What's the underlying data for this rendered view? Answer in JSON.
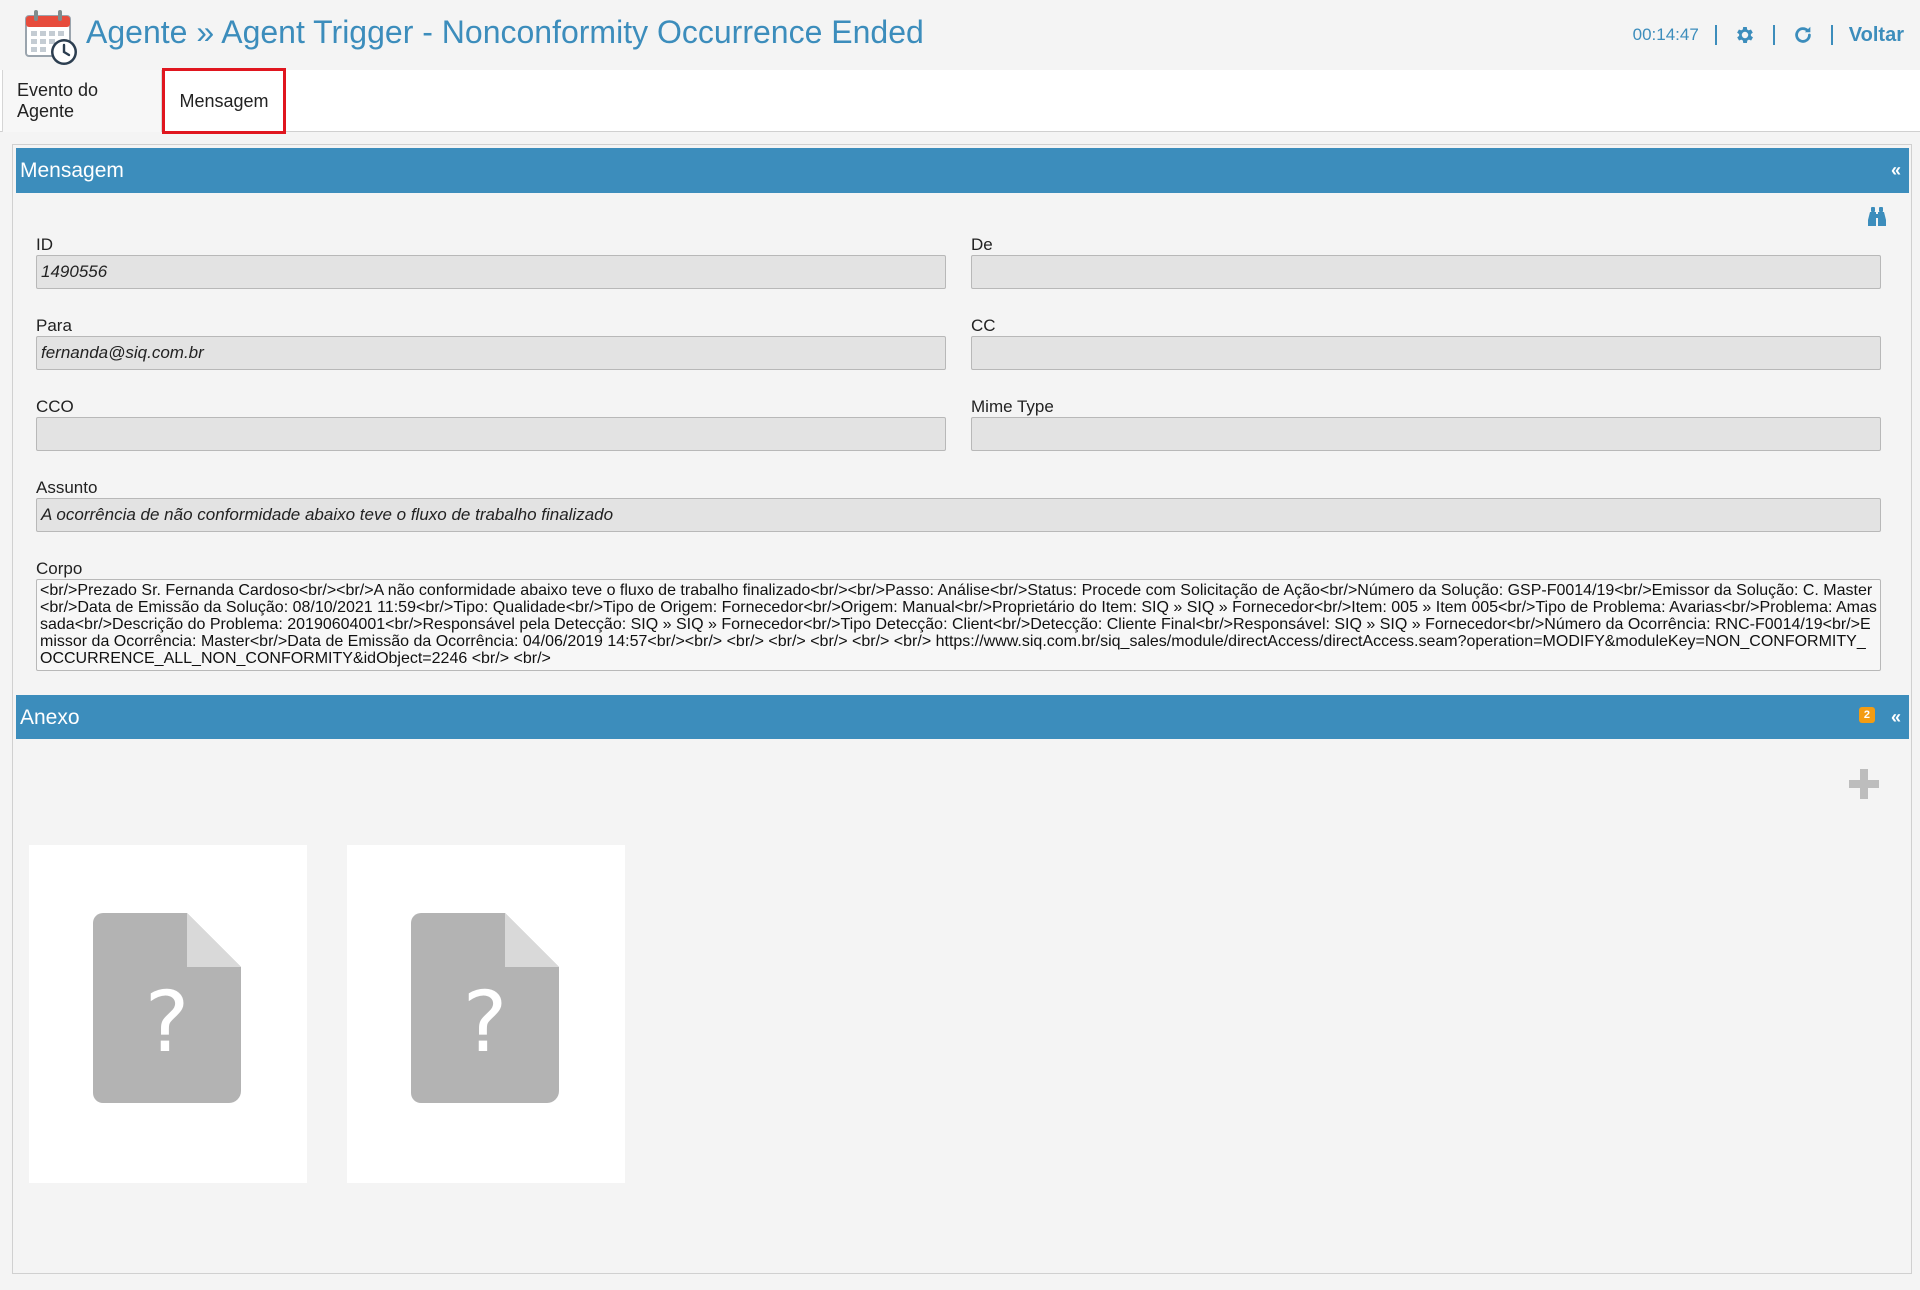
{
  "header": {
    "title": "Agente » Agent Trigger - Nonconformity Occurrence Ended",
    "timer": "00:14:47",
    "back_label": "Voltar",
    "icons": [
      "calendar-clock-icon",
      "gear-icon",
      "refresh-icon"
    ]
  },
  "tabs": [
    {
      "label": "Evento do Agente",
      "active": false
    },
    {
      "label": "Mensagem",
      "active": true
    }
  ],
  "mensagem": {
    "title": "Mensagem",
    "collapse_glyph": "«",
    "fields": {
      "id": {
        "label": "ID",
        "value": "1490556"
      },
      "de": {
        "label": "De",
        "value": ""
      },
      "para": {
        "label": "Para",
        "value": "fernanda@siq.com.br"
      },
      "cc": {
        "label": "CC",
        "value": ""
      },
      "cco": {
        "label": "CCO",
        "value": ""
      },
      "mime": {
        "label": "Mime Type",
        "value": ""
      },
      "assunto": {
        "label": "Assunto",
        "value": "A ocorrência de não conformidade abaixo teve o fluxo de trabalho finalizado"
      },
      "corpo": {
        "label": "Corpo",
        "value": "<br/>Prezado Sr. Fernanda Cardoso<br/><br/>A não conformidade abaixo teve o fluxo de trabalho finalizado<br/><br/>Passo: Análise<br/>Status: Procede com Solicitação de Ação<br/>Número da Solução: GSP-F0014/19<br/>Emissor da Solução: C. Master<br/>Data de Emissão da Solução: 08/10/2021 11:59<br/>Tipo: Qualidade<br/>Tipo de Origem: Fornecedor<br/>Origem: Manual<br/>Proprietário do Item: SIQ » SIQ » Fornecedor<br/>Item: 005 » Item 005<br/>Tipo de Problema: Avarias<br/>Problema: Amassada<br/>Descrição do Problema: 20190604001<br/>Responsável pela Detecção: SIQ » SIQ » Fornecedor<br/>Tipo Detecção: Client<br/>Detecção: Cliente Final<br/>Responsável: SIQ » SIQ » Fornecedor<br/>Número da Ocorrência: RNC-F0014/19<br/>Emissor da Ocorrência: Master<br/>Data de Emissão da Ocorrência: 04/06/2019 14:57<br/><br/>  <br/>  <br/> <br/> <br/> <br/> https://www.siq.com.br/siq_sales/module/directAccess/directAccess.seam?operation=MODIFY&moduleKey=NON_CONFORMITY_OCCURRENCE_ALL_NON_CONFORMITY&idObject=2246 <br/> <br/>"
      }
    }
  },
  "anexo": {
    "title": "Anexo",
    "badge": "2",
    "collapse_glyph": "«",
    "files": [
      {
        "icon": "unknown-file-icon",
        "glyph": "?"
      },
      {
        "icon": "unknown-file-icon",
        "glyph": "?"
      }
    ]
  },
  "colors": {
    "accent": "#3c8dbc",
    "highlight": "#e0161f",
    "badge": "#f39c12",
    "file_icon": "#b3b3b3"
  }
}
